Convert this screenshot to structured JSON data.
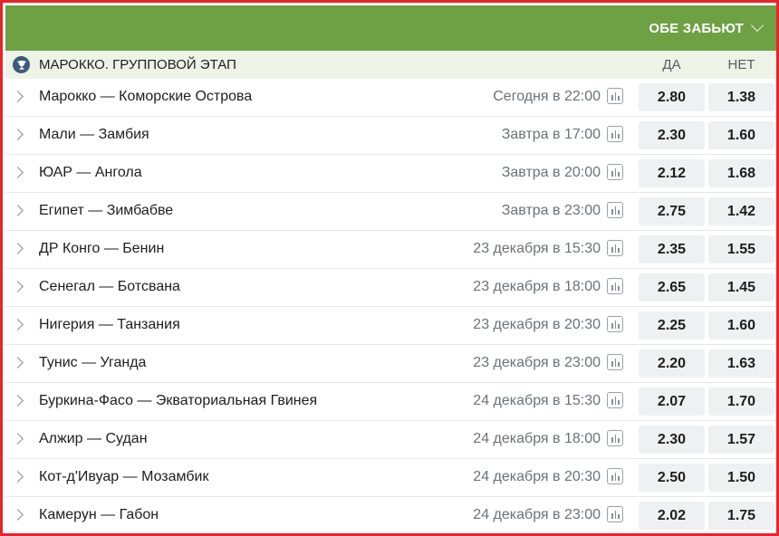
{
  "header": {
    "market_label": "ОБЕ ЗАБЬЮТ"
  },
  "group": {
    "title": "МАРОККО. ГРУППОВОЙ ЭТАП",
    "col_yes": "ДА",
    "col_no": "НЕТ"
  },
  "matches": [
    {
      "teams": "Марокко — Коморские Острова",
      "time": "Сегодня в 22:00",
      "yes": "2.80",
      "no": "1.38"
    },
    {
      "teams": "Мали — Замбия",
      "time": "Завтра в 17:00",
      "yes": "2.30",
      "no": "1.60"
    },
    {
      "teams": "ЮАР — Ангола",
      "time": "Завтра в 20:00",
      "yes": "2.12",
      "no": "1.68"
    },
    {
      "teams": "Египет — Зимбабве",
      "time": "Завтра в 23:00",
      "yes": "2.75",
      "no": "1.42"
    },
    {
      "teams": "ДР Конго — Бенин",
      "time": "23 декабря в 15:30",
      "yes": "2.35",
      "no": "1.55"
    },
    {
      "teams": "Сенегал — Ботсвана",
      "time": "23 декабря в 18:00",
      "yes": "2.65",
      "no": "1.45"
    },
    {
      "teams": "Нигерия — Танзания",
      "time": "23 декабря в 20:30",
      "yes": "2.25",
      "no": "1.60"
    },
    {
      "teams": "Тунис — Уганда",
      "time": "23 декабря в 23:00",
      "yes": "2.20",
      "no": "1.63"
    },
    {
      "teams": "Буркина-Фасо — Экваториальная Гвинея",
      "time": "24 декабря в 15:30",
      "yes": "2.07",
      "no": "1.70"
    },
    {
      "teams": "Алжир — Судан",
      "time": "24 декабря в 18:00",
      "yes": "2.30",
      "no": "1.57"
    },
    {
      "teams": "Кот-д'Ивуар — Мозамбик",
      "time": "24 декабря в 20:30",
      "yes": "2.50",
      "no": "1.50"
    },
    {
      "teams": "Камерун — Габон",
      "time": "24 декабря в 23:00",
      "yes": "2.02",
      "no": "1.75"
    }
  ],
  "colors": {
    "header_green": "#6ea044",
    "group_bg": "#edf3e6",
    "frame_red": "#e8232a",
    "odds_bg": "#eef0f2"
  },
  "icons": {
    "group": "trophy-icon",
    "row": "chevron-right-icon",
    "stats": "bar-chart-icon",
    "market": "chevron-down-icon"
  }
}
